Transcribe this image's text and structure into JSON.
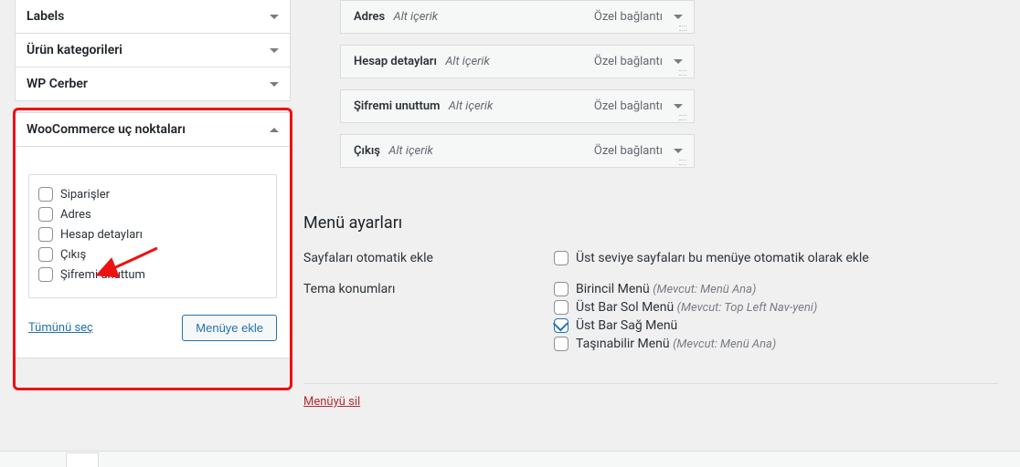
{
  "sidebar": {
    "items": [
      {
        "label": "Labels",
        "open": false
      },
      {
        "label": "Ürün kategorileri",
        "open": false
      },
      {
        "label": "WP Cerber",
        "open": false
      },
      {
        "label": "WooCommerce uç noktaları",
        "open": true
      }
    ],
    "endpoints": [
      {
        "label": "Siparişler"
      },
      {
        "label": "Adres"
      },
      {
        "label": "Hesap detayları"
      },
      {
        "label": "Çıkış"
      },
      {
        "label": "Şifremi unuttum"
      }
    ],
    "select_all": "Tümünü seç",
    "add_to_menu": "Menüye ekle"
  },
  "menu_items": [
    {
      "title": "Adres",
      "sub": "Alt içerik",
      "type": "Özel bağlantı"
    },
    {
      "title": "Hesap detayları",
      "sub": "Alt içerik",
      "type": "Özel bağlantı"
    },
    {
      "title": "Şifremi unuttum",
      "sub": "Alt içerik",
      "type": "Özel bağlantı"
    },
    {
      "title": "Çıkış",
      "sub": "Alt içerik",
      "type": "Özel bağlantı"
    }
  ],
  "settings": {
    "heading": "Menü ayarları",
    "auto_add_label": "Sayfaları otomatik ekle",
    "auto_add_option": "Üst seviye sayfaları bu menüye otomatik olarak ekle",
    "locations_label": "Tema konumları",
    "locations": [
      {
        "label": "Birincil Menü",
        "current": "(Mevcut: Menü Ana)",
        "checked": false
      },
      {
        "label": "Üst Bar Sol Menü",
        "current": "(Mevcut: Top Left Nav-yeni)",
        "checked": false
      },
      {
        "label": "Üst Bar Sağ Menü",
        "current": "",
        "checked": true
      },
      {
        "label": "Taşınabilir Menü",
        "current": "(Mevcut: Menü Ana)",
        "checked": false
      }
    ]
  },
  "delete_menu": "Menüyü sil"
}
